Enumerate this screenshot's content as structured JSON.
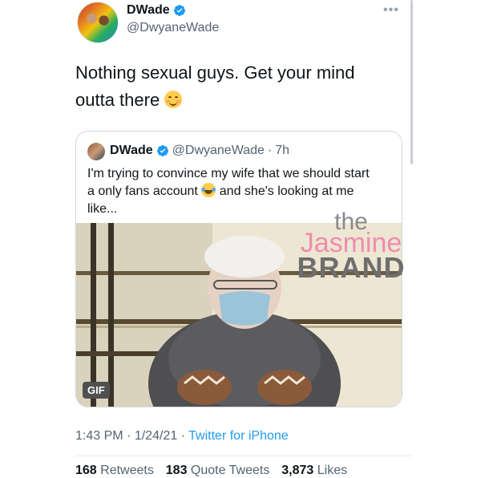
{
  "author": {
    "display_name": "DWade",
    "handle": "@DwyaneWade",
    "verified_icon": "verified-badge-icon",
    "more_icon": "more-options-icon"
  },
  "tweet": {
    "text_line1": "Nothing sexual guys. Get your mind",
    "text_line2": "outta there",
    "emoji": "smiling-face-icon"
  },
  "quoted_tweet": {
    "display_name": "DWade",
    "handle": "@DwyaneWade",
    "separator": "·",
    "age": "7h",
    "text_line1": "I'm trying to convince my wife that we should start",
    "text_line2_a": "a only fans account",
    "text_line2_b": "and she's looking at me",
    "text_line3": "like...",
    "emoji": "face-with-tears-of-joy-icon",
    "media_badge": "GIF"
  },
  "watermark": {
    "line1": "the",
    "line2": "Jasmine",
    "line3": "BRAND"
  },
  "meta": {
    "time": "1:43 PM",
    "date": "1/24/21",
    "separator": "·",
    "source": "Twitter for iPhone"
  },
  "stats": {
    "retweets_count": "168",
    "retweets_label": "Retweets",
    "quotes_count": "183",
    "quotes_label": "Quote Tweets",
    "likes_count": "3,873",
    "likes_label": "Likes"
  },
  "colors": {
    "accent": "#1d9bf0",
    "secondary_text": "#536471",
    "watermark_pink": "#f08cae"
  }
}
